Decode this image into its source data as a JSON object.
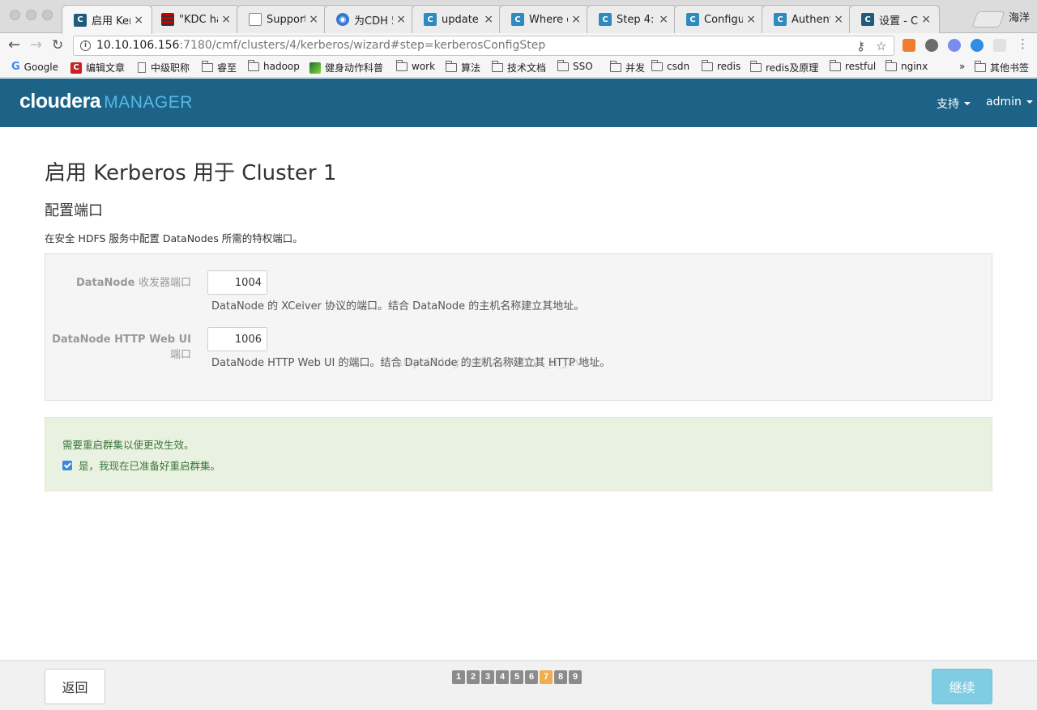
{
  "browser": {
    "tabs": [
      {
        "title": "启用 Kerb",
        "icon": "cloudera-icon",
        "active": true
      },
      {
        "title": "\"KDC has",
        "icon": "stripes-icon"
      },
      {
        "title": "Support |",
        "icon": "document-icon"
      },
      {
        "title": "为CDH 5.7",
        "icon": "globe-icon"
      },
      {
        "title": "update ke",
        "icon": "confluence-icon"
      },
      {
        "title": "Where do",
        "icon": "confluence-icon"
      },
      {
        "title": "Step 4: C",
        "icon": "confluence-icon"
      },
      {
        "title": "Configurin",
        "icon": "confluence-icon"
      },
      {
        "title": "Authentica",
        "icon": "confluence-icon"
      },
      {
        "title": "设置 - Clo",
        "icon": "cloudera-icon"
      }
    ],
    "profile_name": "海洋",
    "url_host": "10.10.106.156",
    "url_rest": ":7180/cmf/clusters/4/kerberos/wizard#step=kerberosConfigStep",
    "bookmarks": [
      {
        "label": "Google",
        "icon": "google-icon"
      },
      {
        "label": "编辑文章",
        "icon": "csdn-icon"
      },
      {
        "label": "中级职称",
        "icon": "document-icon"
      },
      {
        "label": "睿至",
        "icon": "folder-icon"
      },
      {
        "label": "hadoop",
        "icon": "folder-icon"
      },
      {
        "label": "健身动作科普",
        "icon": "fitness-icon"
      },
      {
        "label": "work",
        "icon": "folder-icon"
      },
      {
        "label": "算法",
        "icon": "folder-icon"
      },
      {
        "label": "技术文档",
        "icon": "folder-icon"
      },
      {
        "label": "SSO",
        "icon": "folder-icon"
      },
      {
        "label": "并发",
        "icon": "folder-icon"
      },
      {
        "label": "csdn",
        "icon": "folder-icon"
      },
      {
        "label": "redis",
        "icon": "folder-icon"
      },
      {
        "label": "redis及原理",
        "icon": "folder-icon"
      },
      {
        "label": "restful",
        "icon": "folder-icon"
      },
      {
        "label": "nginx",
        "icon": "folder-icon"
      }
    ],
    "bookmarks_overflow": "»",
    "other_bookmarks": "其他书签"
  },
  "header": {
    "logo_main": "cloudera",
    "logo_sub": "MANAGER",
    "support_label": "支持",
    "user_label": "admin"
  },
  "page": {
    "title": "启用 Kerberos 用于 Cluster 1",
    "section_title": "配置端口",
    "section_desc": "在安全 HDFS 服务中配置 DataNodes 所需的特权端口。"
  },
  "form": {
    "field1": {
      "label": "DataNode",
      "label_sub": "收发器端口",
      "value": "1004",
      "help": "DataNode 的 XCeiver 协议的端口。结合 DataNode 的主机名称建立其地址。"
    },
    "field2": {
      "label": "DataNode HTTP Web UI",
      "label_sub": "端口",
      "value": "1006",
      "help": "DataNode HTTP Web UI 的端口。结合 DataNode 的主机名称建立其 HTTP 地址。"
    }
  },
  "watermark": "http://blog.csdn.net/fine_ii_java",
  "alert": {
    "message": "需要重启群集以使更改生效。",
    "checkbox_label": "是，我现在已准备好重启群集。",
    "checked": true
  },
  "footer": {
    "back_label": "返回",
    "next_label": "继续",
    "steps": [
      "1",
      "2",
      "3",
      "4",
      "5",
      "6",
      "7",
      "8",
      "9"
    ],
    "current_step": "7"
  }
}
